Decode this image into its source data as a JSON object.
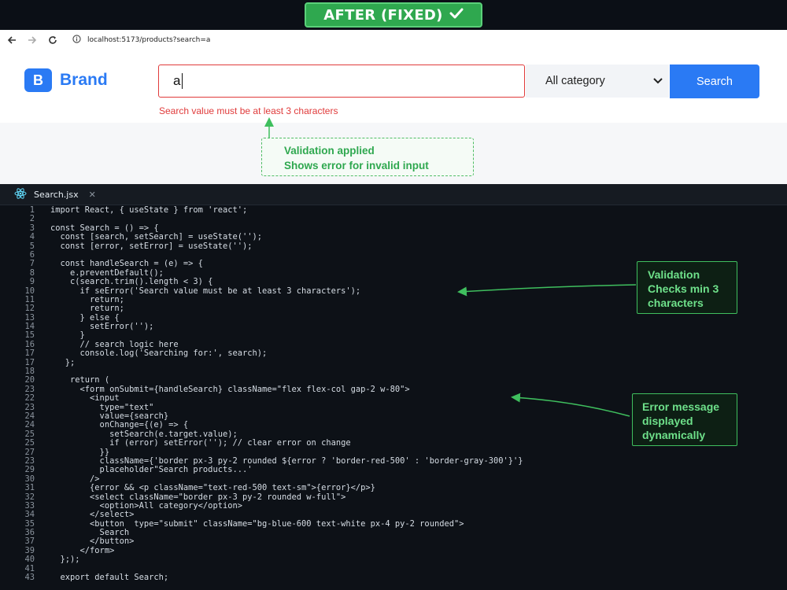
{
  "banner": {
    "label": "AFTER (FIXED)",
    "check_icon": "check-icon"
  },
  "browser": {
    "back_icon": "arrow-left-icon",
    "forward_icon": "arrow-right-icon",
    "reload_icon": "reload-icon",
    "info_icon": "info-icon",
    "url": "localhost:5173/products?search=a"
  },
  "app": {
    "logo_letter": "B",
    "logo_text": "Brand",
    "search_value": "a",
    "category_selected": "All category",
    "search_button": "Search",
    "error_message": "Search value must be at least 3 characters"
  },
  "annotation_top": {
    "line1": "Validation applied",
    "line2": "Shows error for invalid input"
  },
  "editor": {
    "tab_name": "Search.jsx",
    "lines": [
      {
        "n": "1",
        "t": "import React, { useState } from 'react';"
      },
      {
        "n": "2",
        "t": ""
      },
      {
        "n": "3",
        "t": "const Search = () => {"
      },
      {
        "n": "4",
        "t": "  const [search, setSearch] = useState('');"
      },
      {
        "n": "5",
        "t": "  const [error, setError] = useState('');"
      },
      {
        "n": "6",
        "t": ""
      },
      {
        "n": "7",
        "t": "  const handleSearch = (e) => {"
      },
      {
        "n": "8",
        "t": "    e.preventDefault();"
      },
      {
        "n": "9",
        "t": "    c(search.trim().length < 3) {"
      },
      {
        "n": "10",
        "t": "      if seError('Search value must be at least 3 characters');"
      },
      {
        "n": "11",
        "t": "        return;"
      },
      {
        "n": "12",
        "t": "        return;"
      },
      {
        "n": "13",
        "t": "      } else {"
      },
      {
        "n": "14",
        "t": "        setError('');"
      },
      {
        "n": "15",
        "t": "      }"
      },
      {
        "n": "16",
        "t": "      // search logic here"
      },
      {
        "n": "17",
        "t": "      console.log('Searching for:', search);"
      },
      {
        "n": "17",
        "t": "   };"
      },
      {
        "n": "18",
        "t": ""
      },
      {
        "n": "20",
        "t": "    return ("
      },
      {
        "n": "23",
        "t": "      <form onSubmit={handleSearch} className=\"flex flex-col gap-2 w-80\">"
      },
      {
        "n": "22",
        "t": "        <input"
      },
      {
        "n": "23",
        "t": "          type=\"text\""
      },
      {
        "n": "24",
        "t": "          value={search}"
      },
      {
        "n": "24",
        "t": "          onChange={(e) => {"
      },
      {
        "n": "25",
        "t": "            setSearch(e.target.value);"
      },
      {
        "n": "25",
        "t": "            if (error) setError(''); // clear error on change"
      },
      {
        "n": "27",
        "t": "          }}"
      },
      {
        "n": "23",
        "t": "          className={'border px-3 py-2 rounded ${error ? 'border-red-500' : 'border-gray-300'}'}"
      },
      {
        "n": "29",
        "t": "          placeholder\"Search products...'"
      },
      {
        "n": "30",
        "t": "        />"
      },
      {
        "n": "31",
        "t": "        {error && <p className=\"text-red-500 text-sm\">{error}</p>}"
      },
      {
        "n": "32",
        "t": "        <select className=\"border px-3 py-2 rounded w-full\">"
      },
      {
        "n": "33",
        "t": "          <option>All category</option>"
      },
      {
        "n": "34",
        "t": "        </select>"
      },
      {
        "n": "35",
        "t": "        <button  type=\"submit\" className=\"bg-blue-600 text-white px-4 py-2 rounded\">"
      },
      {
        "n": "36",
        "t": "          Search"
      },
      {
        "n": "37",
        "t": "        </button>"
      },
      {
        "n": "39",
        "t": "      </form>"
      },
      {
        "n": "40",
        "t": "  };);"
      },
      {
        "n": "41",
        "t": ""
      },
      {
        "n": "43",
        "t": "  export default Search;"
      }
    ]
  },
  "annotation_validation": {
    "line1": "Validation",
    "line2": "Checks min 3",
    "line3": "characters"
  },
  "annotation_error": {
    "line1": "Error message",
    "line2": "displayed",
    "line3": "dynamically"
  }
}
